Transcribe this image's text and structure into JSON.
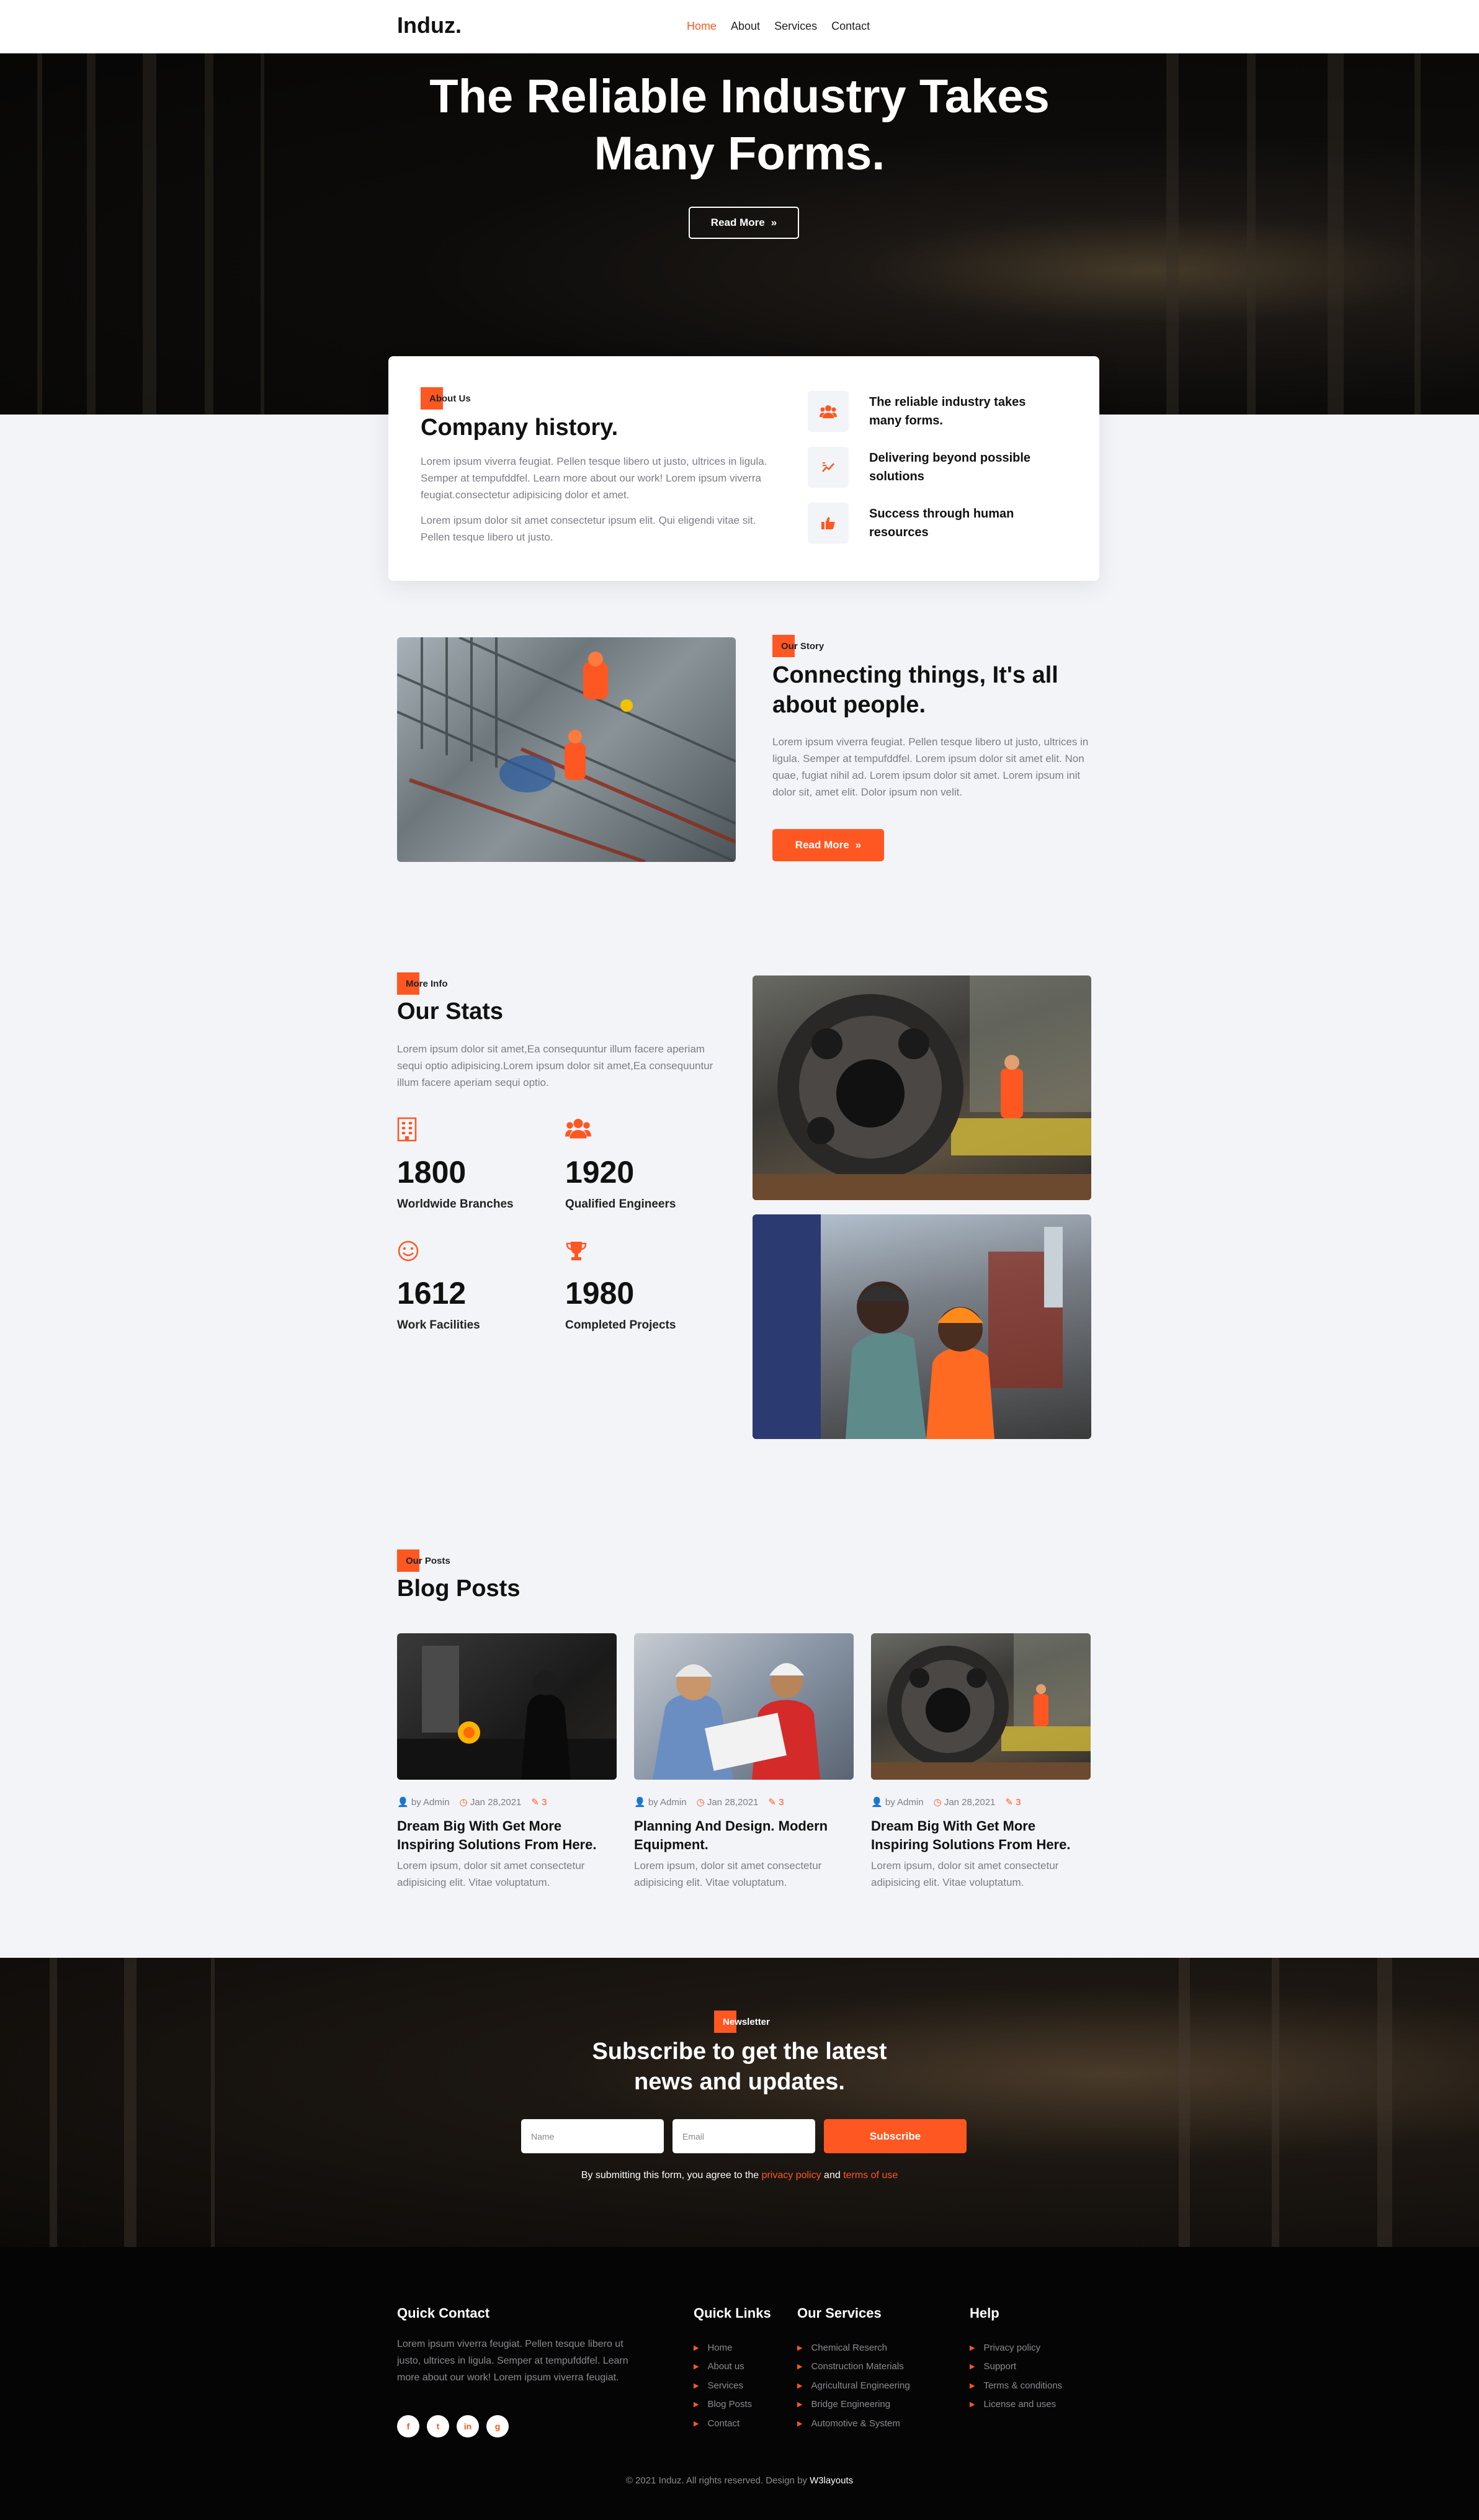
{
  "nav": {
    "logo": "Induz.",
    "links": [
      {
        "label": "Home",
        "active": true
      },
      {
        "label": "About",
        "active": false
      },
      {
        "label": "Services",
        "active": false
      },
      {
        "label": "Contact",
        "active": false
      }
    ]
  },
  "hero": {
    "title_line1": "The Reliable Industry Takes",
    "title_line2": "Many Forms.",
    "button": "Read More"
  },
  "about": {
    "tag": "About Us",
    "title": "Company history.",
    "para1": "Lorem ipsum viverra feugiat. Pellen tesque libero ut justo, ultrices in ligula. Semper at tempufddfel. Learn more about our work! Lorem ipsum viverra feugiat.consectetur adipisicing dolor et amet.",
    "para2": "Lorem ipsum dolor sit amet consectetur ipsum elit. Qui eligendi vitae sit. Pellen tesque libero ut justo.",
    "features": [
      {
        "icon": "users-icon",
        "text": "The reliable industry takes many forms."
      },
      {
        "icon": "chart-icon",
        "text": "Delivering beyond possible solutions"
      },
      {
        "icon": "thumbs-up-icon",
        "text": "Success through human resources"
      }
    ]
  },
  "story": {
    "tag": "Our Story",
    "title_line1": "Connecting things, It's all",
    "title_line2": "about people.",
    "para": "Lorem ipsum viverra feugiat. Pellen tesque libero ut justo, ultrices in ligula. Semper at tempufddfel. Lorem ipsum dolor sit amet elit. Non quae, fugiat nihil ad. Lorem ipsum dolor sit amet. Lorem ipsum init dolor sit, amet elit. Dolor ipsum non velit.",
    "button": "Read More"
  },
  "stats": {
    "tag": "More Info",
    "title": "Our Stats",
    "para": "Lorem ipsum dolor sit amet,Ea consequuntur illum facere aperiam sequi optio adipisicing.Lorem ipsum dolor sit amet,Ea consequuntur illum facere aperiam sequi optio.",
    "items": [
      {
        "icon": "building-icon",
        "value": "1800",
        "label": "Worldwide Branches"
      },
      {
        "icon": "users-icon",
        "value": "1920",
        "label": "Qualified Engineers"
      },
      {
        "icon": "smile-icon",
        "value": "1612",
        "label": "Work Facilities"
      },
      {
        "icon": "trophy-icon",
        "value": "1980",
        "label": "Completed Projects"
      }
    ]
  },
  "blog": {
    "tag": "Our Posts",
    "title": "Blog Posts",
    "posts": [
      {
        "author": "by Admin",
        "date": "Jan 28,2021",
        "comments": "3",
        "title": "Dream Big With Get More Inspiring Solutions From Here.",
        "desc": "Lorem ipsum, dolor sit amet consectetur adipisicing elit. Vitae voluptatum."
      },
      {
        "author": "by Admin",
        "date": "Jan 28,2021",
        "comments": "3",
        "title": "Planning And Design. Modern Equipment.",
        "desc": "Lorem ipsum, dolor sit amet consectetur adipisicing elit. Vitae voluptatum."
      },
      {
        "author": "by Admin",
        "date": "Jan 28,2021",
        "comments": "3",
        "title": "Dream Big With Get More Inspiring Solutions From Here.",
        "desc": "Lorem ipsum, dolor sit amet consectetur adipisicing elit. Vitae voluptatum."
      }
    ]
  },
  "newsletter": {
    "tag": "Newsletter",
    "title_line1": "Subscribe to get the latest",
    "title_line2": "news and updates.",
    "name_placeholder": "Name",
    "email_placeholder": "Email",
    "button": "Subscribe",
    "agree_prefix": "By submitting this form, you agree to the",
    "privacy": "privacy policy",
    "and": "and",
    "terms": "terms of use"
  },
  "footer": {
    "contact_title": "Quick Contact",
    "contact_text": "Lorem ipsum viverra feugiat. Pellen tesque libero ut justo, ultrices in ligula. Semper at tempufddfel. Learn more about our work! Lorem ipsum viverra feugiat.",
    "social": [
      "f",
      "t",
      "in",
      "g"
    ],
    "links_title": "Quick Links",
    "links": [
      "Home",
      "About us",
      "Services",
      "Blog Posts",
      "Contact"
    ],
    "services_title": "Our Services",
    "services": [
      "Chemical Reserch",
      "Construction Materials",
      "Agricultural Engineering",
      "Bridge Engineering",
      "Automotive & System"
    ],
    "help_title": "Help",
    "help": [
      "Privacy policy",
      "Support",
      "Terms & conditions",
      "License and uses"
    ],
    "copyright": "© 2021 Induz. All rights reserved. Design by",
    "designer": "W3layouts"
  },
  "colors": {
    "accent": "#ff5722",
    "dark": "#050505",
    "bg": "#f3f4f8"
  }
}
